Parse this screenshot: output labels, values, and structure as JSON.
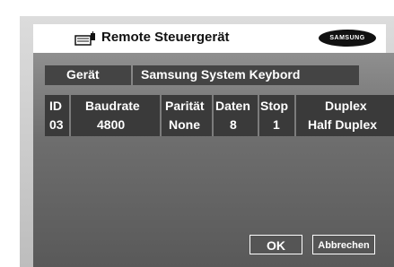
{
  "title": "Remote Steuergerät",
  "brand_logo": "SAMSUNG",
  "device": {
    "label": "Gerät",
    "value": "Samsung System Keybord"
  },
  "table": {
    "headers": [
      "ID",
      "Baudrate",
      "Parität",
      "Daten",
      "Stop",
      "Duplex"
    ],
    "row": [
      "03",
      "4800",
      "None",
      "8",
      "1",
      "Half Duplex"
    ]
  },
  "buttons": {
    "ok": "OK",
    "cancel": "Abbrechen"
  },
  "icons": {
    "title": "remote-control-icon"
  },
  "colors": {
    "panel": "#6e6e6e",
    "field": "#444444",
    "table": "#3a3a3a",
    "frame": "#cfcfcf"
  }
}
